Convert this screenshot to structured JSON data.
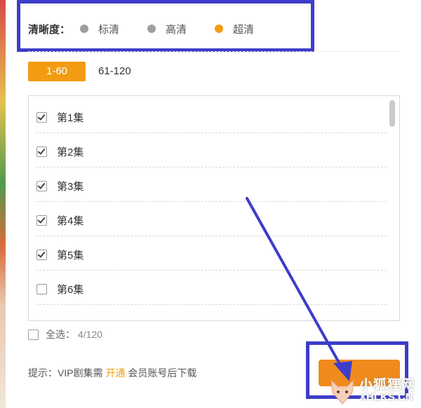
{
  "quality": {
    "label": "清晰度：",
    "options": [
      {
        "label": "标清",
        "selected": false
      },
      {
        "label": "高清",
        "selected": false
      },
      {
        "label": "超清",
        "selected": true
      }
    ]
  },
  "ranges": {
    "active": "1-60",
    "inactive": "61-120"
  },
  "episodes": [
    {
      "label": "第1集",
      "checked": true
    },
    {
      "label": "第2集",
      "checked": true
    },
    {
      "label": "第3集",
      "checked": true
    },
    {
      "label": "第4集",
      "checked": true
    },
    {
      "label": "第5集",
      "checked": true
    },
    {
      "label": "第6集",
      "checked": false
    }
  ],
  "select_all": {
    "label": "全选：",
    "count": "4/120",
    "checked": false
  },
  "hint": {
    "prefix": "提示：VIP剧集需",
    "link": "开通",
    "suffix": "会员账号后下载"
  },
  "download": {
    "label": ""
  },
  "colors": {
    "accent": "#f39c12",
    "annotation": "#3d3dc9"
  },
  "watermark": {
    "text1": "小狐狸网",
    "text2": "XHLKS.CN"
  }
}
